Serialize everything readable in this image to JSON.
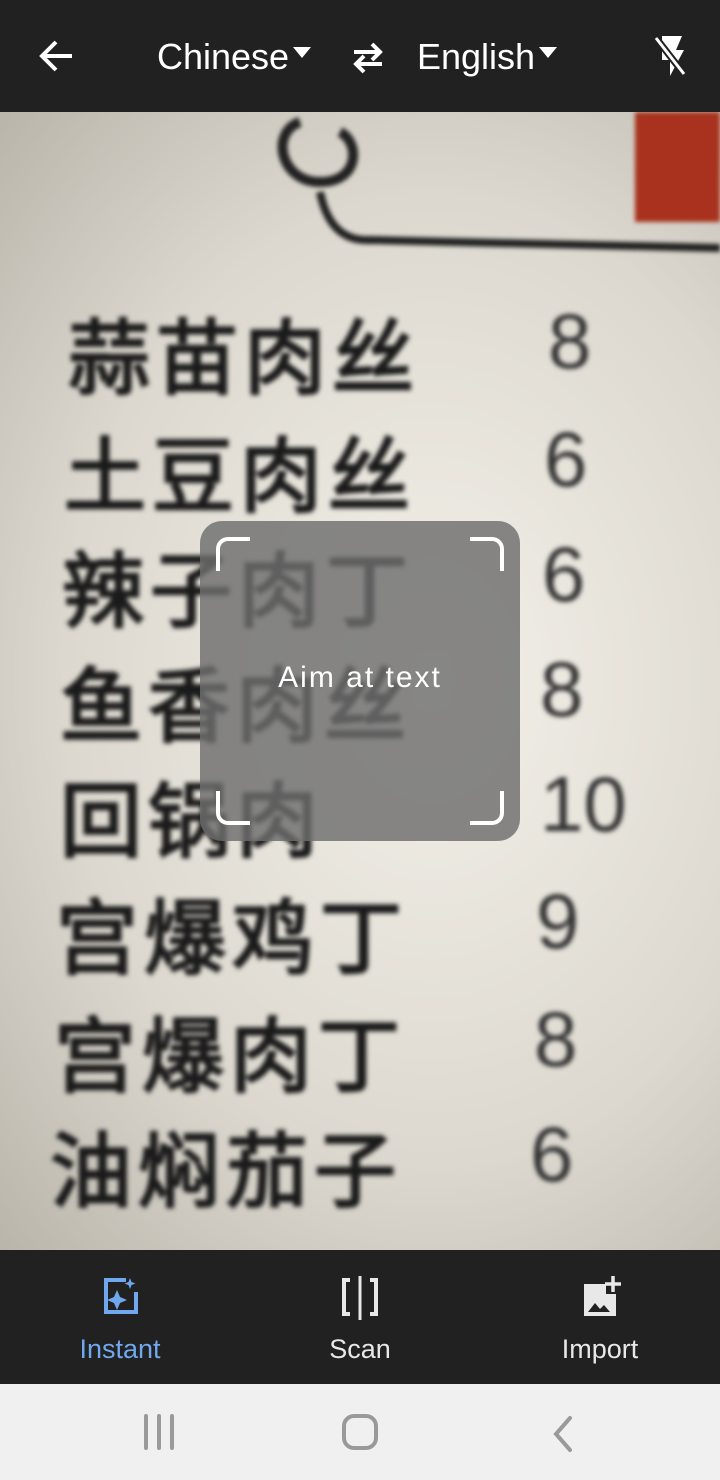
{
  "header": {
    "back_icon": "arrow-left-icon",
    "source_language": "Chinese",
    "swap_icon": "swap-arrows-icon",
    "target_language": "English",
    "flash_icon": "flash-off-icon"
  },
  "camera": {
    "menu_items": [
      {
        "dish": "蒜苗肉丝",
        "price": "8"
      },
      {
        "dish": "土豆肉丝",
        "price": "6"
      },
      {
        "dish": "辣子肉丁",
        "price": "6"
      },
      {
        "dish": "鱼香肉丝",
        "price": "8"
      },
      {
        "dish": "回锅肉",
        "price": "10"
      },
      {
        "dish": "宫爆鸡丁",
        "price": "9"
      },
      {
        "dish": "宫爆肉丁",
        "price": "8"
      },
      {
        "dish": "油焖茄子",
        "price": "6"
      }
    ],
    "hint": "Aim at text"
  },
  "modes": {
    "active_color": "#6fa8ef",
    "items": [
      {
        "label": "Instant",
        "icon": "instant-sparkle-icon",
        "active": true
      },
      {
        "label": "Scan",
        "icon": "scan-icon",
        "active": false
      },
      {
        "label": "Import",
        "icon": "import-image-icon",
        "active": false
      }
    ]
  },
  "system_nav": {
    "recents_icon": "recents-icon",
    "home_icon": "home-icon",
    "back_icon": "back-chevron-icon"
  }
}
